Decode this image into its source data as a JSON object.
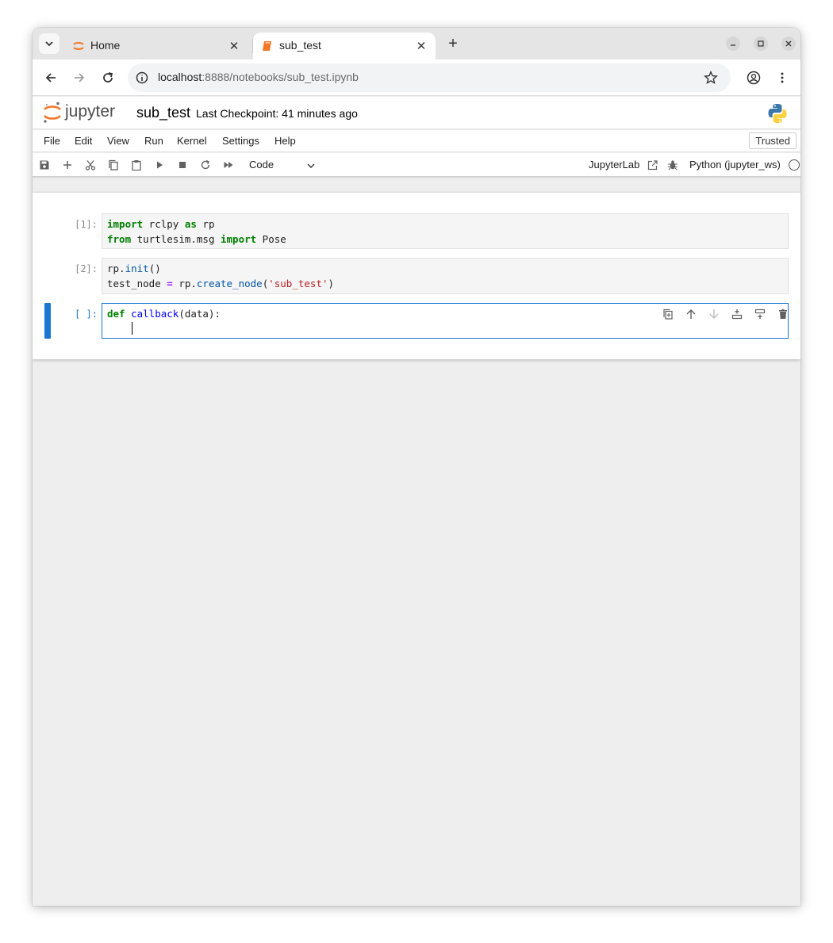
{
  "browser": {
    "tabs": [
      {
        "title": "Home",
        "icon": "jupyter-icon"
      },
      {
        "title": "sub_test",
        "icon": "notebook-icon"
      }
    ],
    "url_host": "localhost",
    "url_rest": ":8888/notebooks/sub_test.ipynb"
  },
  "jupyter": {
    "logo_text": "jupyter",
    "notebook_title": "sub_test",
    "checkpoint": "Last Checkpoint: 41 minutes ago",
    "menu": [
      "File",
      "Edit",
      "View",
      "Run",
      "Kernel",
      "Settings",
      "Help"
    ],
    "trusted": "Trusted",
    "cell_type": "Code",
    "jupyterlab_link": "JupyterLab",
    "kernel_name": "Python (jupyter_ws)"
  },
  "cells": [
    {
      "prompt": "[1]:",
      "lines": [
        "import rclpy as rp",
        "from turtlesim.msg import Pose"
      ]
    },
    {
      "prompt": "[2]:",
      "lines": [
        "rp.init()",
        "test_node = rp.create_node('sub_test')"
      ]
    },
    {
      "prompt": "[ ]:",
      "lines": [
        "def callback(data):",
        "    "
      ]
    }
  ],
  "colors": {
    "accent": "#1976d2",
    "jupyter_orange": "#f37726",
    "keyword": "#008000",
    "string": "#ba2121"
  }
}
